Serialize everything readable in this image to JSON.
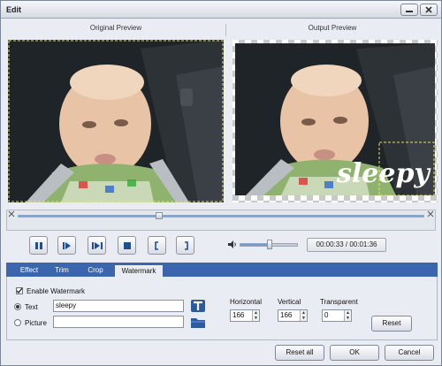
{
  "window": {
    "title": "Edit"
  },
  "previews": {
    "original_label": "Original Preview",
    "output_label": "Output Preview",
    "watermark_overlay": "sleepy"
  },
  "playback": {
    "time": "00:00:33 / 00:01:36",
    "position_fraction": 0.35,
    "volume_fraction": 0.55
  },
  "tabs": [
    {
      "label": "Effect",
      "active": false
    },
    {
      "label": "Trim",
      "active": false
    },
    {
      "label": "Crop",
      "active": false
    },
    {
      "label": "Watermark",
      "active": true
    }
  ],
  "watermark": {
    "enable_label": "Enable Watermark",
    "enabled": true,
    "text_label": "Text",
    "text_value": "sleepy",
    "picture_label": "Picture",
    "picture_value": "",
    "horizontal_label": "Horizontal",
    "horizontal_value": "166",
    "vertical_label": "Vertical",
    "vertical_value": "166",
    "transparent_label": "Transparent",
    "transparent_value": "0",
    "reset_label": "Reset"
  },
  "footer": {
    "reset_all_label": "Reset all",
    "ok_label": "OK",
    "cancel_label": "Cancel"
  }
}
